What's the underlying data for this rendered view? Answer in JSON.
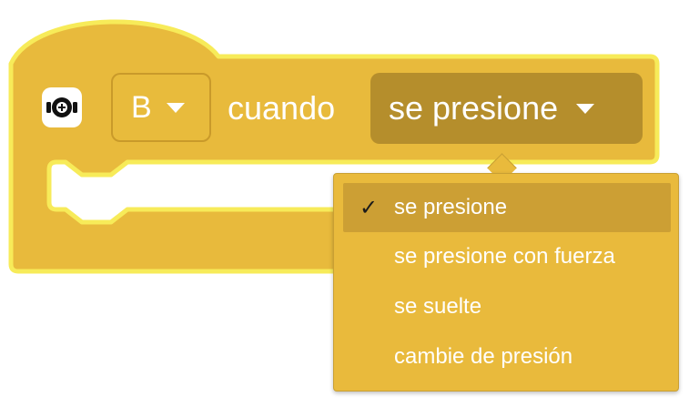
{
  "block": {
    "icon": "force-sensor-icon",
    "port_value": "B",
    "cuando_label": "cuando",
    "event_value": "se presione",
    "colors": {
      "block": "#E8BA3C",
      "block_border": "#F5E85A",
      "field_dark": "#B58E2C"
    }
  },
  "dropdown": {
    "items": [
      {
        "label": "se presione",
        "selected": true
      },
      {
        "label": "se presione con fuerza",
        "selected": false
      },
      {
        "label": "se suelte",
        "selected": false
      },
      {
        "label": "cambie de presión",
        "selected": false
      }
    ],
    "check_glyph": "✓"
  }
}
